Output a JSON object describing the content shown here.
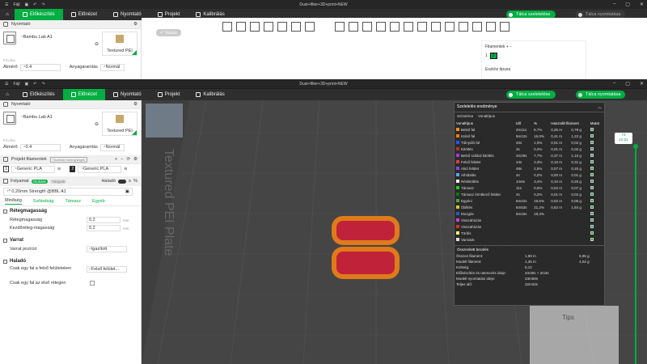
{
  "back_window": {
    "title": "Dust+filter+3D+print+NEW",
    "menu": {
      "file": "Fájl"
    },
    "tabs": [
      "Előkészítés",
      "Előnézet",
      "Nyomtató",
      "Projekt",
      "Kalibrálás"
    ],
    "slice_button": "Tálca szeletelése",
    "print_button": "Tálca nyomtatása",
    "printer_section": "Nyomtató",
    "printer_name": "Bambu Lab A1",
    "plate_name": "Textured PEI",
    "nozzle_label": "Fúvóka",
    "diameter_label": "Átmérő",
    "diameter_value": "0.4",
    "flow_label": "Anyagáramlás",
    "flow_value": "Normál",
    "undo_label": "Vissza",
    "filament_header": "Filamentek",
    "filament_number": "1",
    "filament_slot": "2",
    "seam_type_label": "Eszköz típusa"
  },
  "window": {
    "title": "Dust+filter+3D+print+NEW",
    "menu": {
      "file": "Fájl"
    },
    "tabs": [
      "Előkészítés",
      "Előnézet",
      "Nyomtató",
      "Projekt",
      "Kalibrálás"
    ],
    "slice_button": "Tálca szeletelése",
    "print_button": "Tálca nyomtatása"
  },
  "left_panel": {
    "printer_section": "Nyomtató",
    "printer_name": "Bambu Lab A1",
    "plate_name": "Textured PEI",
    "nozzle_label": "Fúvóka",
    "diameter_label": "Átmérő",
    "diameter_value": "0.4",
    "flow_label": "Anyagáramlás",
    "flow_value": "Normál",
    "project_filaments": "Projekt filamentek",
    "filament_badge": "Tisztítási mennyiségek",
    "filaments": [
      {
        "num": "1",
        "name": "Generic PLA"
      },
      {
        "num": "2",
        "name": "Generic PLA"
      }
    ],
    "process_label": "Folyamat",
    "global_pill": "Globális",
    "object_pill": "Tárgyak",
    "advanced_label": "Haladó",
    "process_profile": "* 0.20mm Strength @BBL A1",
    "subtabs": [
      "Minőség",
      "Szilárdság",
      "Támasz",
      "Egyéb"
    ],
    "groups": {
      "layer_height": "Rétegmagasság",
      "layer_height_field": "Rétegmagasság",
      "layer_height_value": "0.2",
      "first_layer_field": "Kezdőréteg-magasság",
      "first_layer_value": "0.2",
      "unit": "mm",
      "seam": "Varrat",
      "seam_pos_field": "Varrat pozíció",
      "seam_pos_value": "Igazított",
      "advanced": "Haladó",
      "only_one_wall_field": "Csak egy fal a felső felületeken",
      "only_one_wall_value": "Felső felület...",
      "only_one_first_field": "Csak egy fal az első rétegen"
    }
  },
  "viewport": {
    "plate_text": "Textured PEI Plate",
    "tips": "Tips"
  },
  "results": {
    "title": "Szeletelés eredménye",
    "color_scheme_label": "Színséma",
    "color_scheme_value": "Vonaltípus",
    "columns": [
      "Vonaltípus",
      "Idő",
      "%",
      "Használt filament",
      "Mutat"
    ],
    "rows": [
      {
        "name": "Belső fal",
        "color": "#ff8c1a",
        "time": "2m11s",
        "pct": "6,7%",
        "len": "0,26 m",
        "g": "0,78 g"
      },
      {
        "name": "Külső fal",
        "color": "#ff7a00",
        "time": "5m12s",
        "pct": "16,0%",
        "len": "0,41 m",
        "g": "1,22 g"
      },
      {
        "name": "Túlnyúló fal",
        "color": "#2255ff",
        "time": "20s",
        "pct": "1,0%",
        "len": "0,01 m",
        "g": "0,02 g"
      },
      {
        "name": "Kitöltés",
        "color": "#b23030",
        "time": "3s",
        "pct": "0,2%",
        "len": "0,01 m",
        "g": "0,02 g"
      },
      {
        "name": "Belső szilárd kitöltés",
        "color": "#a23ad6",
        "time": "2m29s",
        "pct": "7,7%",
        "len": "0,37 m",
        "g": "1,10 g"
      },
      {
        "name": "Felső felület",
        "color": "#e53a3a",
        "time": "44s",
        "pct": "2,3%",
        "len": "0,10 m",
        "g": "0,31 g"
      },
      {
        "name": "Alsó felület",
        "color": "#7a4de0",
        "time": "48s",
        "pct": "2,5%",
        "len": "0,07 m",
        "g": "0,20 g"
      },
      {
        "name": "Áthidalás",
        "color": "#5aa0ff",
        "time": "4s",
        "pct": "0,2%",
        "len": "0,00 m",
        "g": "0,01 g"
      },
      {
        "name": "Réskitöltés",
        "color": "#eeeeee",
        "time": "1m6s",
        "pct": "3,4%",
        "len": "0,10 m",
        "g": "0,29 g"
      },
      {
        "name": "Támasz",
        "color": "#22cc22",
        "time": "11s",
        "pct": "0,6%",
        "len": "0,02 m",
        "g": "0,07 g"
      },
      {
        "name": "Támasz érintkező felület",
        "color": "#117711",
        "time": "4s",
        "pct": "0,2%",
        "len": "0,01 m",
        "g": "0,02 g"
      },
      {
        "name": "Egyéni",
        "color": "#44aa44",
        "time": "6m22s",
        "pct": "19,6%",
        "len": "0,02 m",
        "g": "0,06 g"
      },
      {
        "name": "Öblítés",
        "color": "#cccc33",
        "time": "6m53s",
        "pct": "21,2%",
        "len": "0,62 m",
        "g": "1,84 g"
      },
      {
        "name": "Mozgás",
        "color": "#3355cc",
        "time": "6m16s",
        "pct": "19,3%",
        "len": "",
        "g": ""
      },
      {
        "name": "Visszahúzás",
        "color": "#d43ad4",
        "time": "",
        "pct": "",
        "len": "",
        "g": ""
      },
      {
        "name": "Visszahúzás",
        "color": "#cc3333",
        "time": "",
        "pct": "",
        "len": "",
        "g": ""
      },
      {
        "name": "Törlés",
        "color": "#ffff66",
        "time": "",
        "pct": "",
        "len": "",
        "g": ""
      },
      {
        "name": "Varratok",
        "color": "#dddddd",
        "time": "",
        "pct": "",
        "len": "",
        "g": ""
      }
    ],
    "summary_title": "Összesített becslés",
    "summary": [
      {
        "label": "Összes filament:",
        "v1": "1,99 m",
        "v2": "5,95 g"
      },
      {
        "label": "Modell filament:",
        "v1": "1,35 m",
        "v2": "4,02 g"
      },
      {
        "label": "Költség:",
        "v1": "0,12",
        "v2": ""
      },
      {
        "label": "Előkészítés és ütemezés ideje:",
        "v1": "4m30s + 2m3s",
        "v2": ""
      },
      {
        "label": "Modell nyomtatási ideje:",
        "v1": "23m59s",
        "v2": ""
      },
      {
        "label": "Teljes idő:",
        "v1": "32m33s",
        "v2": ""
      }
    ]
  },
  "layer_slider": {
    "top_value": "74",
    "top_height": "10.51"
  },
  "colors": {
    "accent": "#00ae42",
    "model_orange": "#e07a1a",
    "model_red": "#c0223a"
  }
}
